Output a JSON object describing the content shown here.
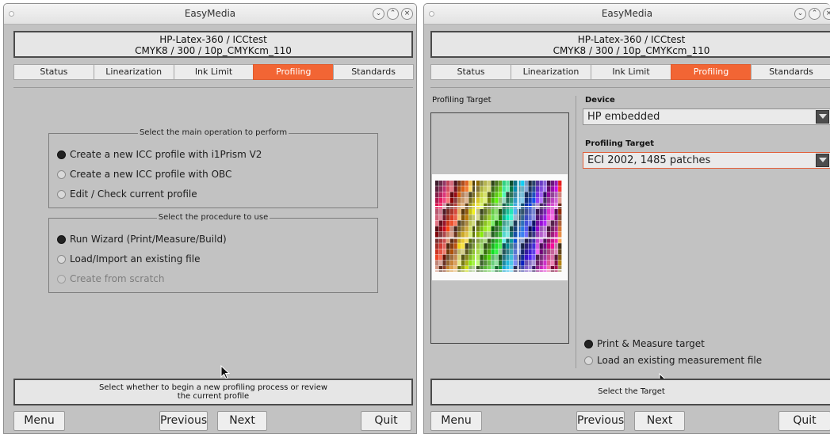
{
  "window_left": {
    "title": "EasyMedia",
    "header": {
      "line1": "HP-Latex-360 / ICCtest",
      "line2": "CMYK8 / 300 / 10p_CMYKcm_110"
    },
    "tabs": [
      {
        "label": "Status"
      },
      {
        "label": "Linearization"
      },
      {
        "label": "Ink Limit"
      },
      {
        "label": "Profiling",
        "active": true
      },
      {
        "label": "Standards"
      }
    ],
    "group_operation": {
      "title": "Select the main operation to perform",
      "options": [
        {
          "label": "Create a new ICC profile with i1Prism V2",
          "selected": true
        },
        {
          "label": "Create a new ICC profile with OBC",
          "selected": false
        },
        {
          "label": "Edit / Check current profile",
          "selected": false
        }
      ]
    },
    "group_procedure": {
      "title": "Select the procedure to use",
      "options": [
        {
          "label": "Run Wizard (Print/Measure/Build)",
          "selected": true
        },
        {
          "label": "Load/Import an existing file",
          "selected": false
        },
        {
          "label": "Create from scratch",
          "selected": false,
          "disabled": true
        }
      ]
    },
    "status": {
      "line1": "Select whether to begin a new profiling process or review",
      "line2": "the current profile"
    },
    "buttons": {
      "menu": "Menu",
      "previous": "Previous",
      "next": "Next",
      "quit": "Quit"
    }
  },
  "window_right": {
    "title": "EasyMedia",
    "header": {
      "line1": "HP-Latex-360 / ICCtest",
      "line2": "CMYK8 / 300 / 10p_CMYKcm_110"
    },
    "tabs": [
      {
        "label": "Status"
      },
      {
        "label": "Linearization"
      },
      {
        "label": "Ink Limit"
      },
      {
        "label": "Profiling",
        "active": true
      },
      {
        "label": "Standards"
      }
    ],
    "left_panel_label": "Profiling Target",
    "device": {
      "label": "Device",
      "value": "HP embedded"
    },
    "profiling_target": {
      "label": "Profiling Target",
      "value": "ECI 2002, 1485 patches"
    },
    "options": [
      {
        "label": "Print & Measure target",
        "selected": true
      },
      {
        "label": "Load an existing measurement file",
        "selected": false
      }
    ],
    "status": "Select the Target",
    "buttons": {
      "menu": "Menu",
      "previous": "Previous",
      "next": "Next",
      "quit": "Quit"
    }
  },
  "colors": {
    "accent_tab": "#f26534",
    "window_bg": "#c2c2c2",
    "box_bg": "#e6e6e6"
  },
  "icons": [
    "window-menu-dot-icon",
    "minimize-icon",
    "maximize-icon",
    "close-icon",
    "dropdown-arrow-icon",
    "mouse-pointer-icon"
  ]
}
